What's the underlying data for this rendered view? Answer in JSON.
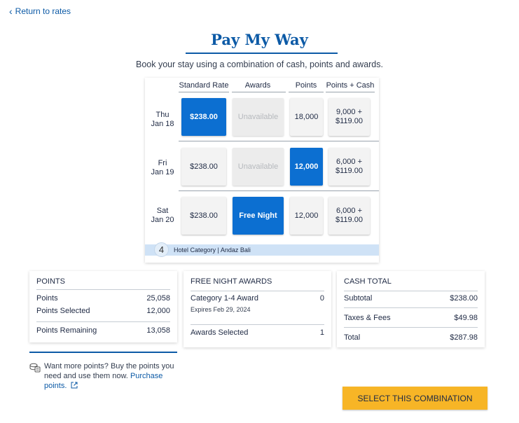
{
  "nav": {
    "back_label": "Return to rates"
  },
  "header": {
    "title": "Pay My Way",
    "subtitle": "Book your stay using a combination of cash, points and awards."
  },
  "rate_table": {
    "columns": [
      "Standard Rate",
      "Awards",
      "Points",
      "Points + Cash"
    ],
    "rows": [
      {
        "day": "Thu",
        "date": "Jan 18",
        "standard": "$238.00",
        "awards": "Unavailable",
        "points": "18,000",
        "combo_points": "9,000 +",
        "combo_cash": "$119.00",
        "selected": "standard"
      },
      {
        "day": "Fri",
        "date": "Jan 19",
        "standard": "$238.00",
        "awards": "Unavailable",
        "points": "12,000",
        "combo_points": "6,000 +",
        "combo_cash": "$119.00",
        "selected": "points"
      },
      {
        "day": "Sat",
        "date": "Jan 20",
        "standard": "$238.00",
        "awards": "Free Night",
        "points": "12,000",
        "combo_points": "6,000 +",
        "combo_cash": "$119.00",
        "selected": "awards"
      }
    ],
    "category_number": "4",
    "category_text": "Hotel Category | Andaz Bali"
  },
  "points_summary": {
    "title": "POINTS",
    "points_label": "Points",
    "points_value": "25,058",
    "selected_label": "Points Selected",
    "selected_value": "12,000",
    "remaining_label": "Points Remaining",
    "remaining_value": "13,058"
  },
  "awards_summary": {
    "title": "FREE NIGHT AWARDS",
    "award_label": "Category 1-4 Award",
    "award_value": "0",
    "expires": "Expires Feb 29, 2024",
    "selected_label": "Awards Selected",
    "selected_value": "1"
  },
  "cash_summary": {
    "title": "CASH TOTAL",
    "subtotal_label": "Subtotal",
    "subtotal_value": "$238.00",
    "taxes_label": "Taxes & Fees",
    "taxes_value": "$49.98",
    "total_label": "Total",
    "total_value": "$287.98"
  },
  "more_points": {
    "text": "Want more points? Buy the points you need and use them now.",
    "link_label": "Purchase points."
  },
  "cta": {
    "label": "SELECT THIS COMBINATION"
  },
  "colors": {
    "brand_blue": "#0c5aa6",
    "selected_cell": "#0c6fd1",
    "cta_yellow": "#f7b526",
    "category_bar": "#cfe2f6"
  },
  "icons": {
    "back": "chevron-left-icon",
    "points": "coins-icon",
    "external_link": "external-link-icon"
  }
}
